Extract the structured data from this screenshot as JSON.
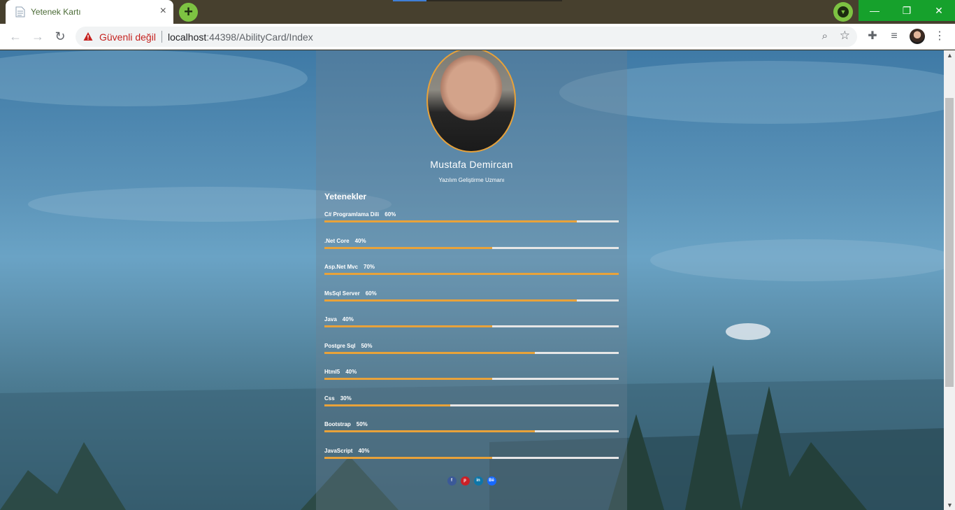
{
  "browser": {
    "tab_title": "Yetenek Kartı",
    "tab_close": "×",
    "new_tab": "+",
    "security_label": "Güvenli değil",
    "url_host": "localhost",
    "url_path": ":44398/AbilityCard/Index",
    "window_controls": {
      "minimize": "—",
      "restore": "❐",
      "close": "✕"
    },
    "icons": [
      "back-icon",
      "forward-icon",
      "reload-icon",
      "warning-icon",
      "zoom-icon",
      "star-icon",
      "extensions-icon",
      "reading-list-icon",
      "avatar",
      "menu-icon"
    ],
    "accent_color": "#7dc242"
  },
  "card": {
    "name": "Mustafa Demircan",
    "role": "Yazılım Geliştirme Uzmanı",
    "skills_title": "Yetenekler",
    "skills": [
      {
        "name": "C# Programlama Dili",
        "percent_label": "60%",
        "fill": 0.857
      },
      {
        "name": ".Net Core",
        "percent_label": "40%",
        "fill": 0.571
      },
      {
        "name": "Asp.Net Mvc",
        "percent_label": "70%",
        "fill": 1.0
      },
      {
        "name": "MsSql Server",
        "percent_label": "60%",
        "fill": 0.857
      },
      {
        "name": "Java",
        "percent_label": "40%",
        "fill": 0.571
      },
      {
        "name": "Postgre Sql",
        "percent_label": "50%",
        "fill": 0.714
      },
      {
        "name": "Html5",
        "percent_label": "40%",
        "fill": 0.571
      },
      {
        "name": "Css",
        "percent_label": "30%",
        "fill": 0.428
      },
      {
        "name": "Bootstrap",
        "percent_label": "50%",
        "fill": 0.714
      },
      {
        "name": "JavaScript",
        "percent_label": "40%",
        "fill": 0.571
      }
    ],
    "social": [
      {
        "name": "facebook",
        "glyph": "f",
        "color": "#3b5998"
      },
      {
        "name": "pinterest",
        "glyph": "p",
        "color": "#cb2027"
      },
      {
        "name": "linkedin",
        "glyph": "in",
        "color": "#0e76a8"
      },
      {
        "name": "behance",
        "glyph": "Bē",
        "color": "#1769ff"
      }
    ],
    "bar_color": "#e8a23a",
    "track_color": "#e6e6e6"
  }
}
